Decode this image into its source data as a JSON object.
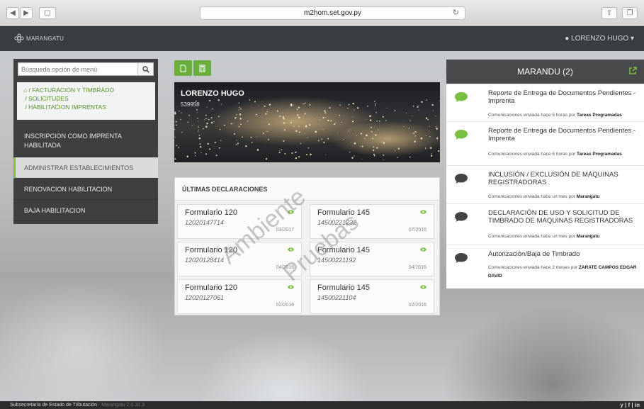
{
  "browser": {
    "url": "m2hom.set.gov.py"
  },
  "app": {
    "logo_text": "MARANGATU",
    "user": "LORENZO HUGO"
  },
  "sidebar": {
    "search_placeholder": "Búsqueda opción de menú",
    "breadcrumb": [
      "/ FACTURACION Y TIMBRADO",
      "/ SOLICITUDES",
      "/ HABILITACION IMPRENTAS"
    ],
    "items": [
      {
        "label": "INSCRIPCION COMO IMPRENTA HABILITADA",
        "active": false
      },
      {
        "label": "ADMINISTRAR ESTABLECIMIENTOS",
        "active": true
      },
      {
        "label": "RENOVACION HABILITACION",
        "active": false
      },
      {
        "label": "BAJA HABILITACION",
        "active": false
      }
    ]
  },
  "profile": {
    "name": "LORENZO HUGO",
    "id": "539958"
  },
  "declarations": {
    "title": "ÚLTIMAS DECLARACIONES",
    "cards": [
      {
        "form": "Formulario 120",
        "number": "12020147714",
        "date": "03/2017"
      },
      {
        "form": "Formulario 145",
        "number": "14500221232",
        "date": "07/2016"
      },
      {
        "form": "Formulario 120",
        "number": "12020128414",
        "date": "04/2016"
      },
      {
        "form": "Formulario 145",
        "number": "14500221192",
        "date": "04/2016"
      },
      {
        "form": "Formulario 120",
        "number": "12020127061",
        "date": "02/2016"
      },
      {
        "form": "Formulario 145",
        "number": "14500221104",
        "date": "02/2016"
      }
    ]
  },
  "watermark": {
    "line1": "Ambiente",
    "line2": "Pruebas"
  },
  "notifications": {
    "title": "MARANDU (2)",
    "items": [
      {
        "title": "Reporte de Entrega de Documentos Pendientes - Imprenta",
        "meta": "Comunicaciones enviada hace 6 horas por ",
        "by": "Tareas Programadas",
        "unread": true
      },
      {
        "title": "Reporte de Entrega de Documentos Pendientes - Imprenta",
        "meta": "Comunicaciones enviada hace 6 horas por ",
        "by": "Tareas Programadas",
        "unread": true
      },
      {
        "title": "INCLUSIÓN / EXCLUSIÓN DE MÁQUINAS REGISTRADORAS",
        "meta": "Comunicaciones enviada hace un mes por ",
        "by": "Marangatu",
        "unread": false
      },
      {
        "title": "DECLARACIÓN DE USO Y SOLICITUD DE TIMBRADO DE MAQUINAS REGISTRADORAS",
        "meta": "Comunicaciones enviada hace un mes por ",
        "by": "Marangatu",
        "unread": false
      },
      {
        "title": "Autorización/Baja de Timbrado",
        "meta": "Comunicaciones enviada hace 2 meses por ",
        "by": "ZARATE CAMPOS EDGAR DAVID",
        "unread": false
      }
    ]
  },
  "footer": {
    "org": "Subsecretaría de Estado de Tributación",
    "version": " - Marangatu 2.0.32.3",
    "social": "y | f | in"
  },
  "colors": {
    "accent": "#7ac143",
    "topbar": "#3a3e40",
    "sidebar": "#3d3f40",
    "unread": "#7ac143",
    "read": "#444444"
  }
}
